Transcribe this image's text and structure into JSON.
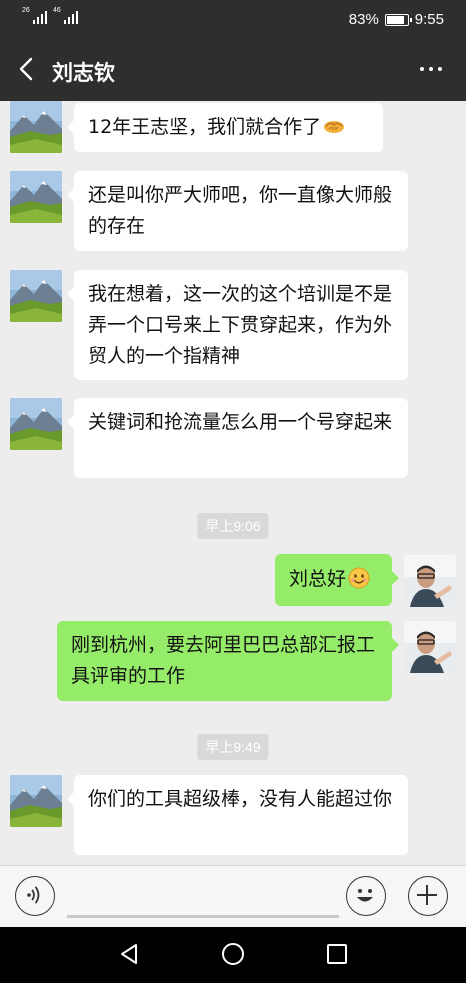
{
  "status_bar": {
    "signal_1_label": "26",
    "signal_2_label": "46",
    "battery_percent": "83%",
    "battery_level": 0.83,
    "time": "9:55"
  },
  "header": {
    "title": "刘志钦",
    "back_icon": "chevron-left-icon",
    "more_icon": "more-dots-icon"
  },
  "messages": [
    {
      "side": "in",
      "text": "12年王志坚，我们就合作了",
      "emoji": "handshake"
    },
    {
      "side": "in",
      "text": "还是叫你严大师吧，你一直像大师般的存在"
    },
    {
      "side": "in",
      "text": "我在想着，这一次的这个培训是不是弄一个口号来上下贯穿起来，作为外贸人的一个指精神"
    },
    {
      "side": "in",
      "text": "关键词和抢流量怎么用一个号穿起来"
    },
    {
      "side": "time",
      "text": "早上9:06"
    },
    {
      "side": "out",
      "text": "刘总好",
      "emoji": "smile"
    },
    {
      "side": "out",
      "text": "刚到杭州，要去阿里巴巴总部汇报工具评审的工作"
    },
    {
      "side": "time",
      "text": "早上9:49"
    },
    {
      "side": "in",
      "text": "你们的工具超级棒，没有人能超过你"
    }
  ],
  "input_bar": {
    "voice_icon": "voice-icon",
    "text_value": "",
    "emoji_icon": "emoji-icon",
    "plus_icon": "plus-icon"
  },
  "nav_bar": {
    "back_icon": "nav-back-icon",
    "home_icon": "nav-home-icon",
    "recent_icon": "nav-recent-icon"
  },
  "colors": {
    "header_bg": "#2e2e2e",
    "chat_bg": "#ededed",
    "incoming_bubble": "#ffffff",
    "outgoing_bubble": "#95ec69"
  }
}
